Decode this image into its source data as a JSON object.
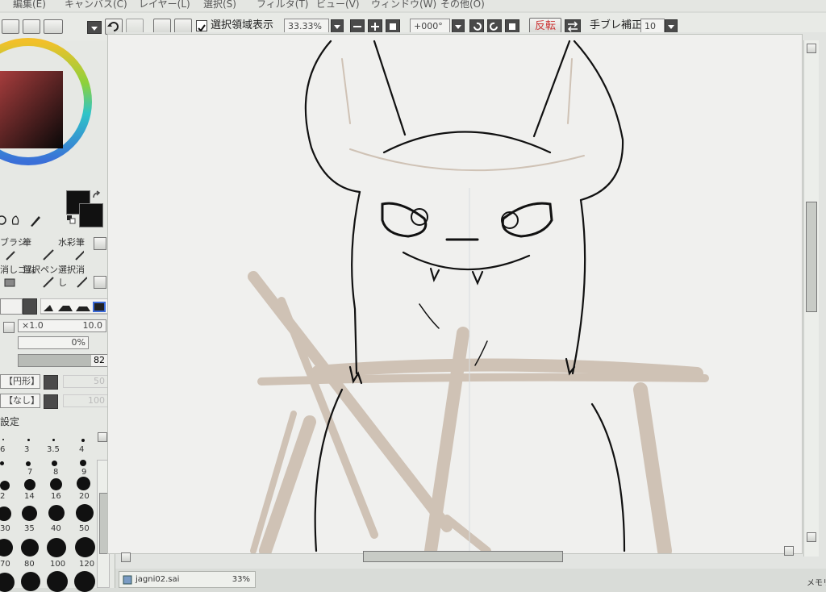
{
  "menu": [
    "編集(E)",
    "キャンバス(C)",
    "レイヤー(L)",
    "選択(S)",
    "フィルタ(T)",
    "ビュー(V)",
    "ウィンドウ(W)",
    "その他(O)"
  ],
  "toolbar": {
    "show_selection_label": "選択領域表示",
    "show_selection_checked": true,
    "zoom_value": "33.33%",
    "rotation_value": "+000°",
    "flip_label": "反転",
    "stabilizer_label": "手ブレ補正",
    "stabilizer_value": "10"
  },
  "tools": {
    "row1": [
      "ブラシ",
      "筆",
      "水彩筆"
    ],
    "row2": [
      "消しゴム",
      "選択ペン",
      "選択消し"
    ]
  },
  "brush": {
    "size_mult": "×1.0",
    "size_value": "10.0",
    "min_size": "0%",
    "density": "82",
    "shape_label": "【円形】",
    "texture_label": "【なし】",
    "shape_strength": "50",
    "texture_strength": "100",
    "detail_label": "設定"
  },
  "brush_sizes": {
    "row1": [
      "3",
      "3.5",
      "4"
    ],
    "row1_first": "6",
    "row2": [
      "7",
      "8",
      "9"
    ],
    "row3": [
      "14",
      "16",
      "20"
    ],
    "row3_first": "2",
    "row4": [
      "35",
      "40",
      "50"
    ],
    "row4_first": "30",
    "row5": [
      "80",
      "100",
      "120"
    ],
    "row5_first": "70"
  },
  "document": {
    "name": "jagni02.sai",
    "zoom": "33%"
  },
  "corner_text": "メモリ",
  "colors": {
    "primary": "#111111",
    "secondary": "#111111"
  }
}
